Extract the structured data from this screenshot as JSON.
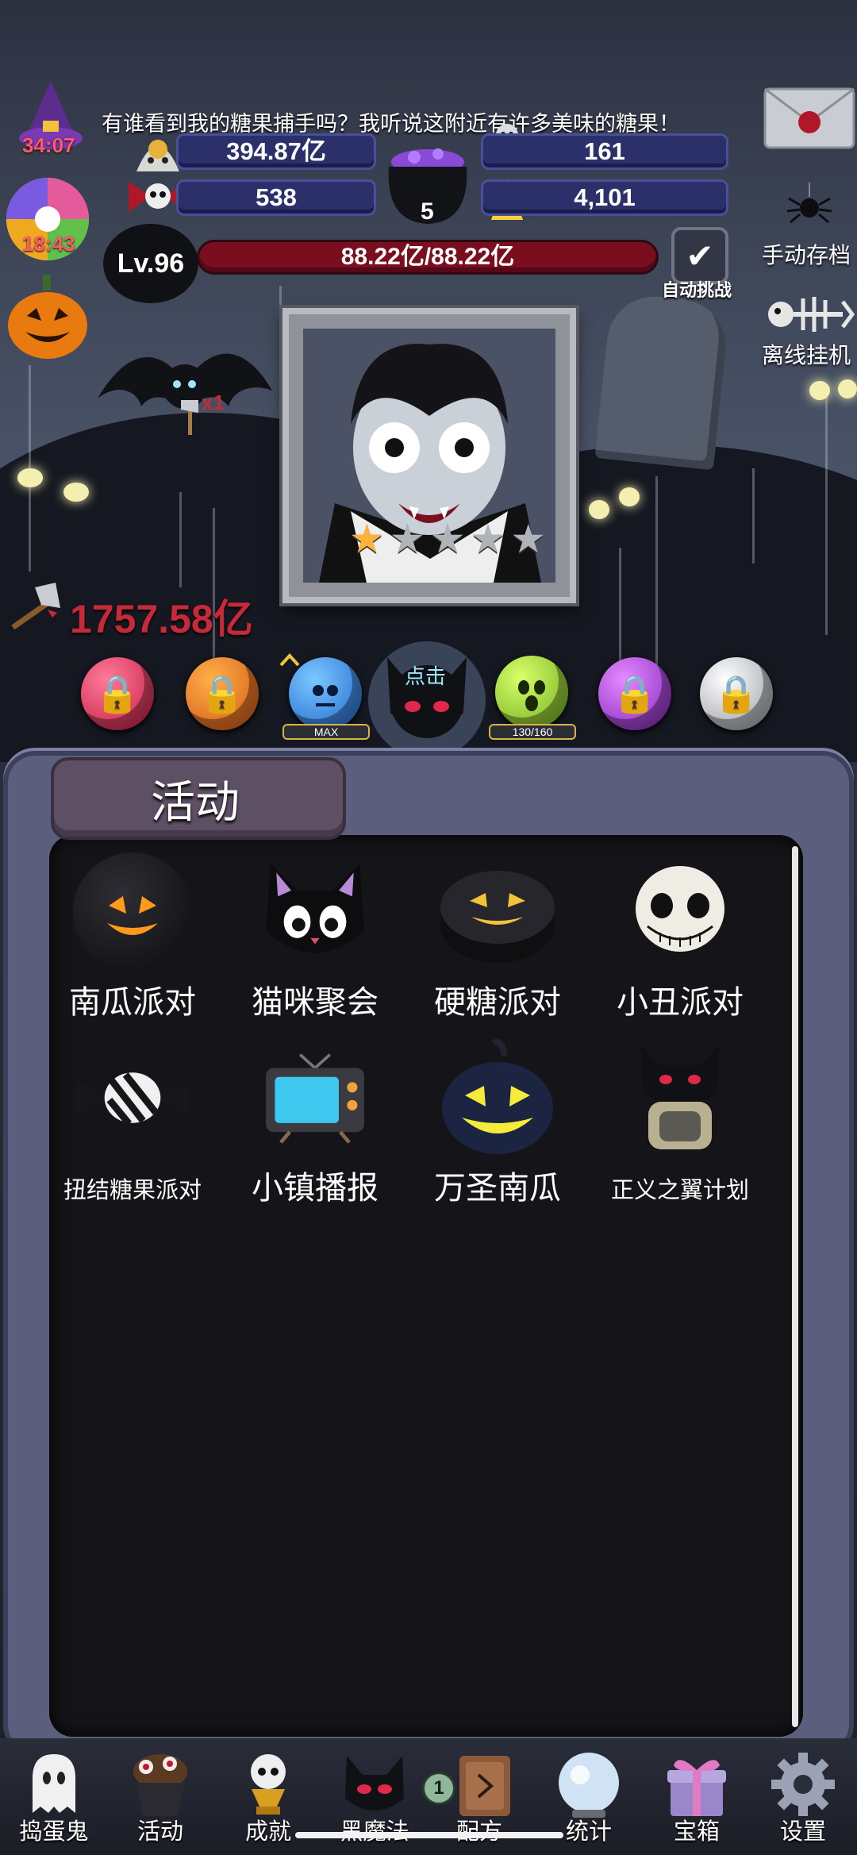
{
  "hud": {
    "message": "有谁看到我的糖果捕手吗？我听说这附近有许多美味的糖果！",
    "timer1": "34:07",
    "timer2": "18:43",
    "gold": "394.87亿",
    "skull": "161",
    "bows": "538",
    "cauldron_count": "5",
    "candy_corn": "4,101",
    "level": "Lv.96",
    "hp": "88.22亿/88.22亿",
    "auto_challenge": "自动挑战",
    "manual_save": "手动存档",
    "offline": "离线挂机",
    "bat_multiplier": "x1",
    "damage": "1757.58亿"
  },
  "portrait": {
    "stars_total": 5,
    "stars_filled": 1
  },
  "orbs": {
    "tap_label": "点击",
    "max_label": "MAX",
    "progress_label": "130/160"
  },
  "panel": {
    "title": "活动",
    "items": [
      {
        "label": "南瓜派对",
        "icon": "jack-o-lantern-icon"
      },
      {
        "label": "猫咪聚会",
        "icon": "black-cat-icon"
      },
      {
        "label": "硬糖派对",
        "icon": "hard-candy-icon"
      },
      {
        "label": "小丑派对",
        "icon": "skull-clown-icon"
      },
      {
        "label": "扭结糖果派对",
        "icon": "twist-candy-icon"
      },
      {
        "label": "小镇播报",
        "icon": "tv-icon"
      },
      {
        "label": "万圣南瓜",
        "icon": "halloween-pumpkin-icon"
      },
      {
        "label": "正义之翼计划",
        "icon": "winged-robot-icon"
      }
    ]
  },
  "nav": {
    "items": [
      {
        "label": "捣蛋鬼",
        "icon": "ghost-icon"
      },
      {
        "label": "活动",
        "icon": "cupcake-icon"
      },
      {
        "label": "成就",
        "icon": "skull-trophy-icon"
      },
      {
        "label": "黑魔法",
        "icon": "dark-bat-icon"
      },
      {
        "label": "配方",
        "icon": "recipe-book-icon"
      },
      {
        "label": "统计",
        "icon": "crystal-ball-icon"
      },
      {
        "label": "宝箱",
        "icon": "gift-box-icon"
      },
      {
        "label": "设置",
        "icon": "gear-icon"
      }
    ],
    "recipe_badge": "1"
  },
  "colors": {
    "accent_red": "#c62a3a",
    "panel": "#5b5f7d",
    "resource_bar": "#2b2f6a"
  }
}
